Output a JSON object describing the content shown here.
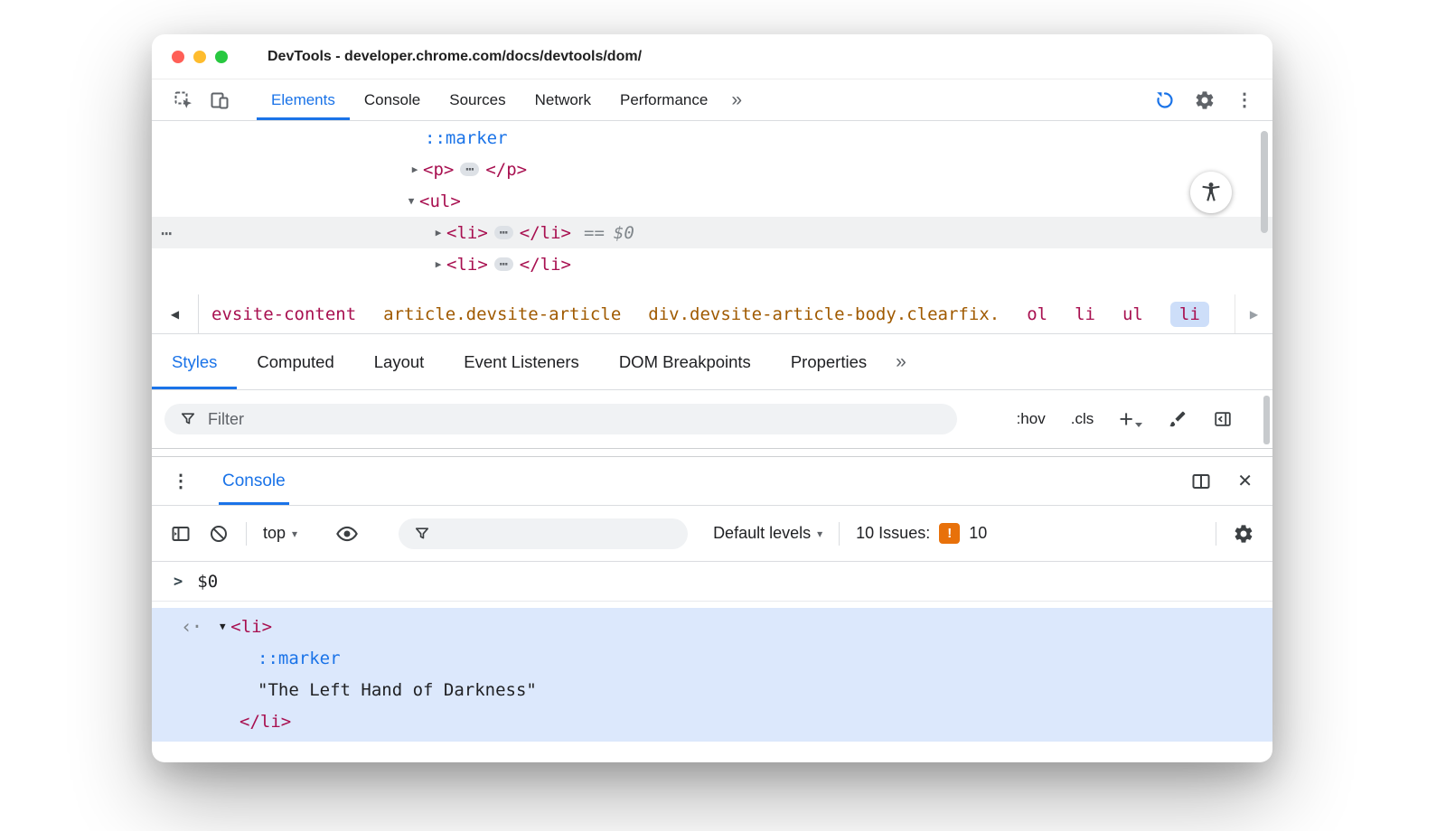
{
  "palette": {
    "accent_blue": "#1a73e8",
    "tag_red": "#a81050",
    "attr_orange": "#a05a00",
    "icon_grey": "#5f6368",
    "text_dark": "#202124",
    "tree_selected_bg": "#f0f1f2",
    "console_result_bg": "#dce8fc",
    "crumb_selected_bg": "#cddef9",
    "issues_orange": "#e8710a"
  },
  "icons": {
    "kebab": "⋮",
    "close": "✕",
    "caret_down": "▾",
    "back": "◀",
    "forward": "▶",
    "collapsed": "▶",
    "expanded": "▼",
    "more_tabs": "»",
    "inline_ellipsis": "⋯",
    "gutter_more": "⋯",
    "plus": "+",
    "result_chevron": "‹·",
    "input_chevron": ">"
  },
  "titlebar": {
    "title": "DevTools - developer.chrome.com/docs/devtools/dom/"
  },
  "main_toolbar": {
    "tabs": [
      "Elements",
      "Console",
      "Sources",
      "Network",
      "Performance"
    ]
  },
  "elements_tree": {
    "marker": "::marker",
    "p_open": "<p>",
    "p_close": "</p>",
    "ul_open": "<ul>",
    "li_open": "<li>",
    "li_close": "</li>",
    "eq": "==",
    "dollar": "$0"
  },
  "breadcrumbs": {
    "items": [
      "evsite-content",
      "article.devsite-article",
      "div.devsite-article-body.clearfix.",
      "ol",
      "li",
      "ul",
      "li"
    ]
  },
  "styles_pane": {
    "tabs": [
      "Styles",
      "Computed",
      "Layout",
      "Event Listeners",
      "DOM Breakpoints",
      "Properties"
    ],
    "filter_label": "Filter",
    "hov": ":hov",
    "cls": ".cls"
  },
  "console_drawer": {
    "tab": "Console",
    "context": "top",
    "levels": "Default levels",
    "issues_label": "10 Issues:",
    "issues_badge": "!",
    "issues_count": "10",
    "input_value": "$0",
    "result": {
      "li_open": "<li>",
      "marker": "::marker",
      "text": "\"The Left Hand of Darkness\"",
      "li_close": "</li>"
    }
  }
}
